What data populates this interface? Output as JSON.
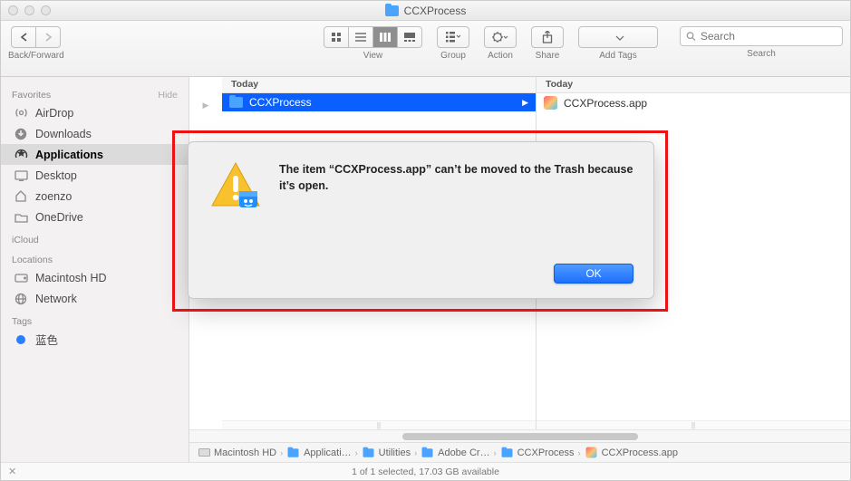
{
  "window": {
    "title": "CCXProcess"
  },
  "toolbar": {
    "back_forward_label": "Back/Forward",
    "view_label": "View",
    "group_label": "Group",
    "action_label": "Action",
    "share_label": "Share",
    "tags_label": "Add Tags",
    "search_label": "Search",
    "search_placeholder": "Search"
  },
  "sidebar": {
    "favorites_label": "Favorites",
    "hide_label": "Hide",
    "icloud_label": "iCloud",
    "locations_label": "Locations",
    "tags_label": "Tags",
    "favorites": [
      {
        "label": "AirDrop",
        "icon": "airdrop"
      },
      {
        "label": "Downloads",
        "icon": "downloads"
      },
      {
        "label": "Applications",
        "icon": "applications",
        "selected": true
      },
      {
        "label": "Desktop",
        "icon": "desktop"
      },
      {
        "label": "zoenzo",
        "icon": "home"
      },
      {
        "label": "OneDrive",
        "icon": "folder"
      }
    ],
    "locations": [
      {
        "label": "Macintosh HD",
        "icon": "hdd"
      },
      {
        "label": "Network",
        "icon": "network"
      }
    ],
    "tags": [
      {
        "label": "蓝色",
        "color": "#2a7fff"
      }
    ]
  },
  "columns": {
    "col0_arrow": "▶",
    "col1": {
      "header": "Today",
      "items": [
        {
          "name": "CCXProcess",
          "type": "folder",
          "selected": true
        }
      ]
    },
    "col2": {
      "header": "Today",
      "items": [
        {
          "name": "CCXProcess.app",
          "type": "app"
        }
      ]
    }
  },
  "path": [
    {
      "label": "Macintosh HD",
      "icon": "hdd"
    },
    {
      "label": "Applicati…",
      "icon": "folder"
    },
    {
      "label": "Utilities",
      "icon": "folder"
    },
    {
      "label": "Adobe Cr…",
      "icon": "folder"
    },
    {
      "label": "CCXProcess",
      "icon": "folder"
    },
    {
      "label": "CCXProcess.app",
      "icon": "app"
    }
  ],
  "status": {
    "text": "1 of 1 selected, 17.03 GB available",
    "close_glyph": "✕"
  },
  "dialog": {
    "message": "The item “CCXProcess.app” can’t be moved to the Trash because it’s open.",
    "ok_label": "OK"
  }
}
